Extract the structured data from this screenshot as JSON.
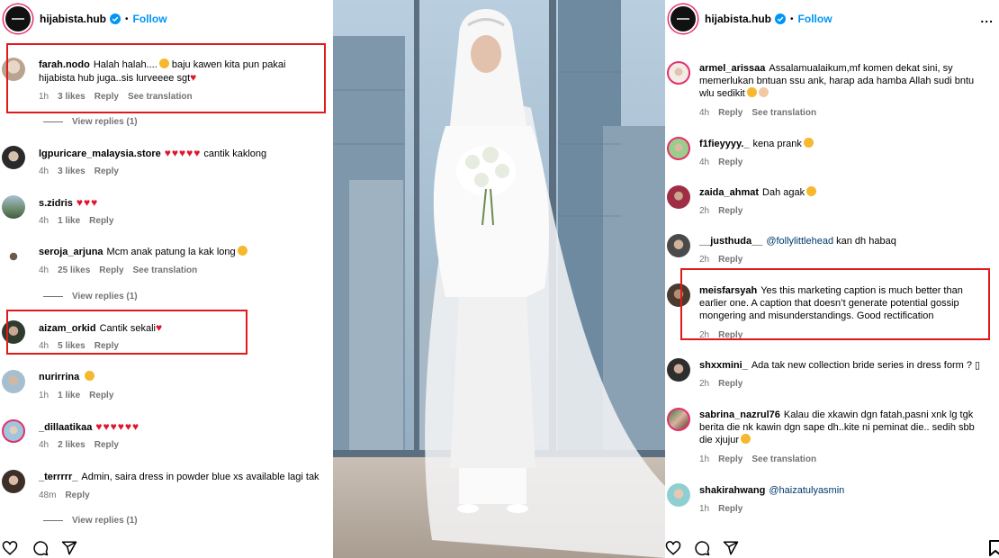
{
  "account": {
    "handle": "hijabista.hub",
    "follow_label": "Follow",
    "separator": "•",
    "more_label": "..."
  },
  "left": {
    "comments": [
      {
        "user": "farah.nodo",
        "text": "Halah halah....",
        "text2": " baju kawen kita pun pakai",
        "line2": "hijabista hub juga..sis lurveeee sgt",
        "time": "1h",
        "likes": "3 likes",
        "reply": "Reply",
        "translate": "See translation"
      },
      {
        "user": "lgpuricare_malaysia.store",
        "text": " cantik kaklong",
        "hearts": "♥♥♥♥♥",
        "time": "4h",
        "likes": "3 likes",
        "reply": "Reply"
      },
      {
        "user": "s.zidris",
        "hearts": "♥♥♥",
        "time": "4h",
        "likes": "1 like",
        "reply": "Reply"
      },
      {
        "user": "seroja_arjuna",
        "text": "Mcm anak patung la kak long",
        "time": "4h",
        "likes": "25 likes",
        "reply": "Reply",
        "translate": "See translation"
      },
      {
        "user": "aizam_orkid",
        "text": "Cantik sekali",
        "time": "4h",
        "likes": "5 likes",
        "reply": "Reply"
      },
      {
        "user": "nurirrina",
        "time": "1h",
        "likes": "1 like",
        "reply": "Reply"
      },
      {
        "user": "_dillaatikaa",
        "hearts": "♥♥♥♥♥♥",
        "time": "4h",
        "likes": "2 likes",
        "reply": "Reply"
      },
      {
        "user": "_terrrrr_",
        "text": "Admin, saira dress in powder blue xs available lagi tak",
        "time": "48m",
        "reply": "Reply"
      }
    ],
    "view_replies": [
      "View replies (1)",
      "View replies (1)",
      "View replies (1)"
    ]
  },
  "right": {
    "comments": [
      {
        "user": "armel_arissaa",
        "text": "Assalamualaikum,mf komen dekat sini, sy",
        "line2": "memerlukan bntuan ssu ank, harap ada hamba Allah sudi bntu",
        "line3": "wlu sedikit",
        "time": "4h",
        "reply": "Reply",
        "translate": "See translation"
      },
      {
        "user": "f1fieyyyy._",
        "text": "kena prank",
        "time": "4h",
        "reply": "Reply"
      },
      {
        "user": "zaida_ahmat",
        "text": "Dah agak",
        "time": "2h",
        "reply": "Reply"
      },
      {
        "user": "__justhuda__",
        "mention": "@follylittlehead",
        "text": " kan dh habaq",
        "time": "2h",
        "reply": "Reply"
      },
      {
        "user": "meisfarsyah",
        "text": "Yes this marketing caption is much better than",
        "line2": "earlier one. A caption that doesn’t generate potential gossip",
        "line3": "mongering and misunderstandings. Good rectification",
        "time": "2h",
        "reply": "Reply"
      },
      {
        "user": "shxxmini_",
        "text": "Ada tak new collection bride series in dress form ? ▯",
        "time": "2h",
        "reply": "Reply"
      },
      {
        "user": "sabrina_nazrul76",
        "text": "Kalau die xkawin dgn fatah,pasni xnk lg tgk",
        "line2": "berita die nk kawin dgn sape dh..kite ni peminat die.. sedih sbb",
        "line3": "die xjujur",
        "time": "1h",
        "reply": "Reply",
        "translate": "See translation"
      },
      {
        "user": "shakirahwang",
        "mention": "@haizatulyasmin",
        "time": "1h",
        "reply": "Reply"
      }
    ]
  },
  "icons": [
    "verified-badge",
    "heart-outline",
    "comment-bubble",
    "send-arrow",
    "bookmark"
  ],
  "colors": {
    "accent": "#0095f6",
    "highlight": "#e01919",
    "heart": "#e0162b",
    "meta": "#737373"
  }
}
